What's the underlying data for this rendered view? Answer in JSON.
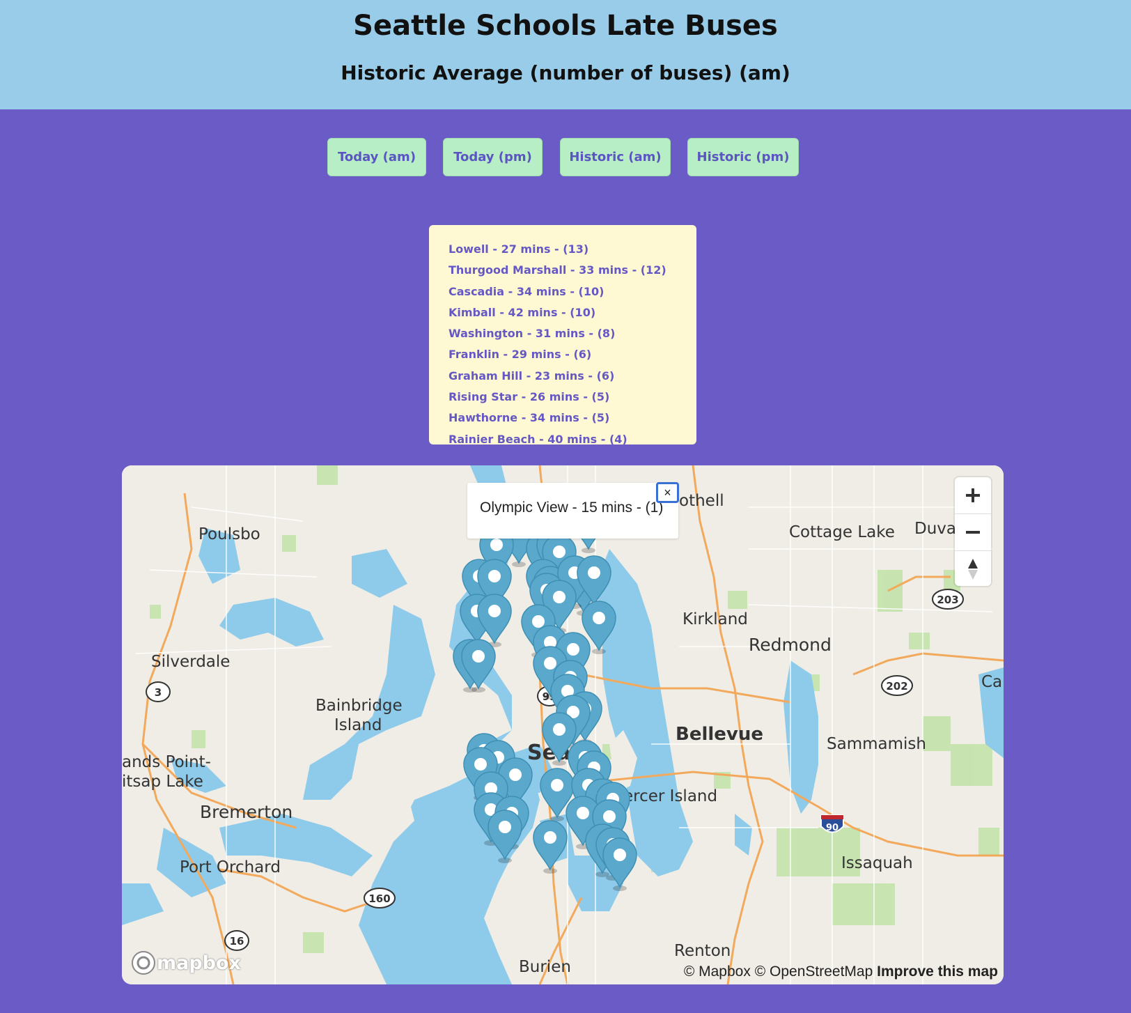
{
  "header": {
    "title": "Seattle Schools Late Buses",
    "subtitle": "Historic Average (number of buses) (am)"
  },
  "buttons": [
    {
      "label": "Today (am)"
    },
    {
      "label": "Today (pm)"
    },
    {
      "label": "Historic (am)"
    },
    {
      "label": "Historic (pm)"
    }
  ],
  "schools": [
    "Lowell - 27 mins - (13)",
    "Thurgood Marshall - 33 mins - (12)",
    "Cascadia - 34 mins - (10)",
    "Kimball - 42 mins - (10)",
    "Washington - 31 mins - (8)",
    "Franklin - 29 mins - (6)",
    "Graham Hill - 23 mins - (6)",
    "Rising Star - 26 mins - (5)",
    "Hawthorne - 34 mins - (5)",
    "Rainier Beach - 40 mins - (4)"
  ],
  "map": {
    "popup_text": "Olympic View - 15 mins - (1)",
    "popup_close": "×",
    "place_labels": {
      "poulsbo": "Poulsbo",
      "silverdale": "Silverdale",
      "bainbridge1": "Bainbridge",
      "bainbridge2": "Island",
      "bremerton": "Bremerton",
      "port_orchard": "Port Orchard",
      "lands_point": "ands Point-",
      "kitsap_lake": "itsap Lake",
      "seattle": "Sea",
      "bothell": "othell",
      "cottage_lake": "Cottage Lake",
      "duvall": "Duval",
      "kirkland": "Kirkland",
      "redmond": "Redmond",
      "bellevue": "Bellevue",
      "sammamish": "Sammamish",
      "mercer_island": "ercer Island",
      "issaquah": "Issaquah",
      "renton": "Renton",
      "burien": "Burien",
      "carnation": "Car"
    },
    "route_shields": {
      "r3": "3",
      "r99": "99",
      "r160": "160",
      "r16": "16",
      "r203": "203",
      "r202": "202",
      "r90": "90"
    },
    "attribution_mapbox": "© Mapbox",
    "attribution_osm": "© OpenStreetMap",
    "attribution_improve": "Improve this map",
    "logo_text": "mapbox",
    "colors": {
      "water": "#8ecbea",
      "land": "#f0ede6",
      "park": "#bfe0a8",
      "road": "#f2a95c",
      "marker": "#5aa9cc"
    }
  }
}
